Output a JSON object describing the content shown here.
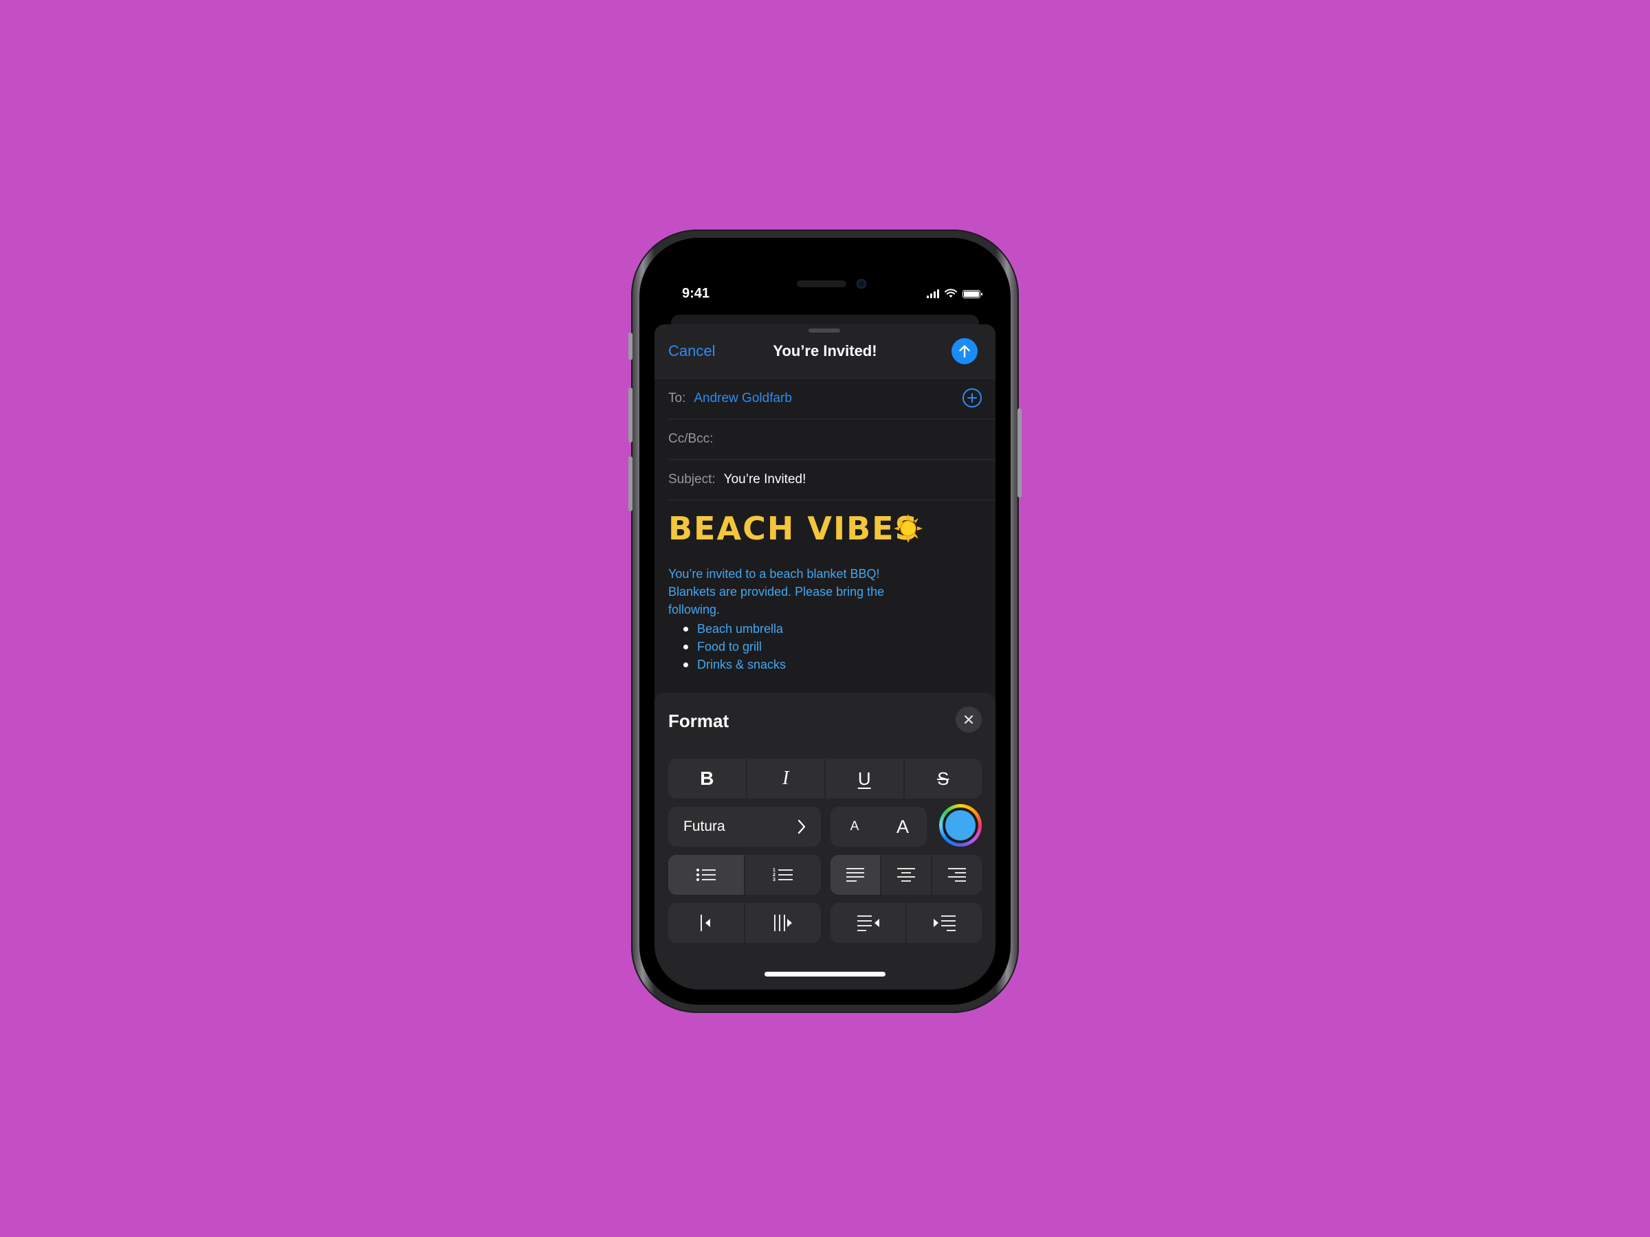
{
  "status_bar": {
    "time": "9:41",
    "signal_icon": "cellular-signal-icon",
    "wifi_icon": "wifi-icon",
    "battery_icon": "battery-icon"
  },
  "compose": {
    "cancel_label": "Cancel",
    "title": "You’re Invited!",
    "send_icon": "arrow-up-icon",
    "to_label": "To:",
    "to_value": "Andrew Goldfarb",
    "add_recipient_icon": "plus-circle-icon",
    "cc_label": "Cc/Bcc:",
    "subject_label": "Subject:",
    "subject_value": "You’re Invited!"
  },
  "message": {
    "headline": "BEACH VIBES",
    "headline_emoji": "sun-icon",
    "paragraph": "You’re invited to a beach blanket BBQ! Blankets are provided. Please bring the following.",
    "bullets": [
      "Beach umbrella",
      "Food to grill",
      "Drinks & snacks"
    ],
    "headline_color": "#f3c63d",
    "text_color": "#42a6f0"
  },
  "format_panel": {
    "title": "Format",
    "close_icon": "close-icon",
    "style_buttons": [
      {
        "label": "B",
        "name": "bold"
      },
      {
        "label": "I",
        "name": "italic"
      },
      {
        "label": "U",
        "name": "underline"
      },
      {
        "label": "S",
        "name": "strikethrough"
      }
    ],
    "font_name": "Futura",
    "font_chevron": "chevron-right-icon",
    "size_small_label": "A",
    "size_large_label": "A",
    "text_color": "#3ea9f2",
    "list_buttons": [
      {
        "name": "bulleted-list",
        "selected": true
      },
      {
        "name": "numbered-list",
        "selected": false
      }
    ],
    "align_buttons": [
      {
        "name": "align-left",
        "selected": true
      },
      {
        "name": "align-center",
        "selected": false
      },
      {
        "name": "align-right",
        "selected": false
      }
    ],
    "indent_buttons": [
      "decrease-indent",
      "increase-indent"
    ],
    "direction_buttons": [
      "right-to-left",
      "left-to-right"
    ]
  },
  "colors": {
    "background": "#c44fc5",
    "accent": "#2d8cf0",
    "send": "#1a8cf5"
  }
}
